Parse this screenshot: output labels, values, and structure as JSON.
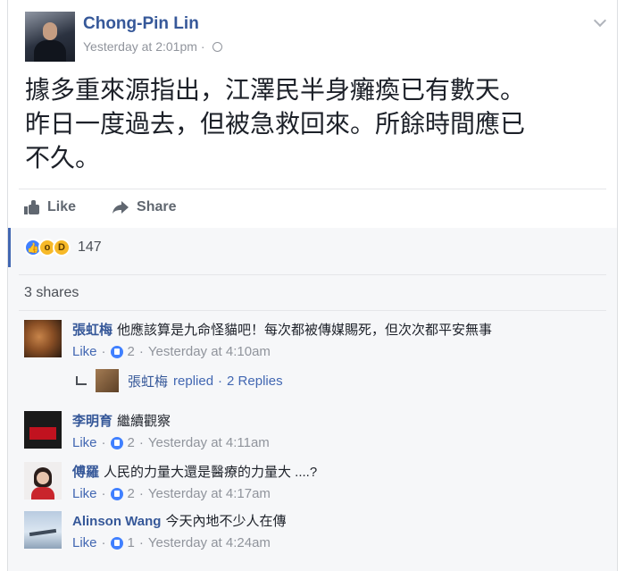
{
  "post": {
    "author": "Chong-Pin Lin",
    "timestamp": "Yesterday at 2:01pm",
    "separator": "·",
    "text_lines": [
      "據多重來源指出，江澤民半身癱瘓已有數天。",
      "昨日一度過去，但被急救回來。所餘時間應已",
      "不久。"
    ],
    "icons": {
      "privacy": "globe-icon",
      "menu": "chevron-down-icon"
    }
  },
  "actions": {
    "like_label": "Like",
    "share_label": "Share"
  },
  "reactions": {
    "count": "147",
    "types": [
      "like",
      "wow",
      "haha"
    ]
  },
  "shares": {
    "label": "3 shares"
  },
  "comments": [
    {
      "name": "張虹梅",
      "text": "他應該算是九命怪貓吧！每次都被傳媒賜死，但次次都平安無事",
      "like_label": "Like",
      "likes": "2",
      "time": "Yesterday at 4:10am"
    },
    {
      "name": "李明育",
      "text": "繼續觀察",
      "like_label": "Like",
      "likes": "2",
      "time": "Yesterday at 4:11am"
    },
    {
      "name": "傅羅",
      "text": "人民的力量大還是醫療的力量大 ....?",
      "like_label": "Like",
      "likes": "2",
      "time": "Yesterday at 4:17am"
    },
    {
      "name": "Alinson Wang",
      "text": "今天內地不少人在傳",
      "like_label": "Like",
      "likes": "1",
      "time": "Yesterday at 4:24am"
    }
  ],
  "reply": {
    "name": "張虹梅",
    "action": "replied",
    "sep": "·",
    "count_label": "2 Replies"
  },
  "colors": {
    "link": "#365899",
    "accent": "#4267b2",
    "muted": "#90949c",
    "like_blue": "#4080ff"
  }
}
